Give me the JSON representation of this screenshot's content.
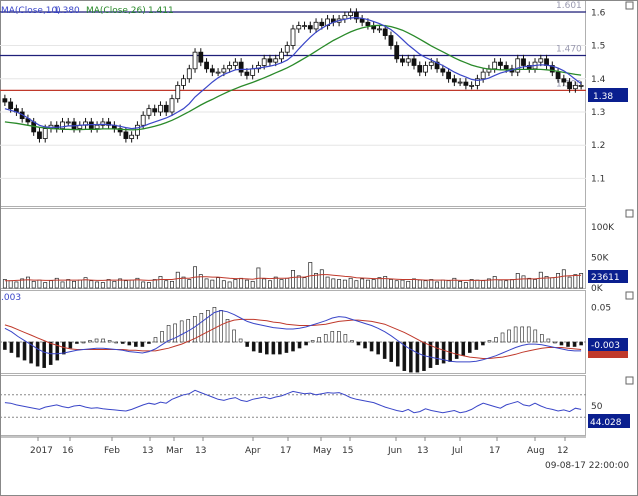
{
  "chart_data": [
    {
      "type": "line",
      "panel": "price",
      "description": "Daily candlestick price chart with moving averages and horizontal level lines",
      "legend": [
        {
          "name": "MA(Close,10)",
          "value_label": "1.380",
          "color": "#3a46c8"
        },
        {
          "name": "MA(Close,26)",
          "value_label": "1.411",
          "color": "#2a8a2a"
        }
      ],
      "y_ticks": [
        "1.6",
        "1.5",
        "1.4",
        "1.3",
        "1.2",
        "1.1"
      ],
      "ylim": [
        1.02,
        1.625
      ],
      "last_price_label": "1.38",
      "levels": [
        {
          "label": "1.601",
          "value": 1.601,
          "color": "#1f1f7a"
        },
        {
          "label": "1.470",
          "value": 1.47,
          "color": "#1f1f7a"
        },
        {
          "label": "1.300",
          "value": 1.365,
          "color": "#c0392b"
        }
      ],
      "close_series": [
        1.33,
        1.31,
        1.3,
        1.28,
        1.27,
        1.24,
        1.22,
        1.25,
        1.26,
        1.25,
        1.27,
        1.27,
        1.25,
        1.26,
        1.27,
        1.25,
        1.26,
        1.27,
        1.26,
        1.25,
        1.24,
        1.22,
        1.23,
        1.26,
        1.29,
        1.31,
        1.3,
        1.32,
        1.3,
        1.34,
        1.38,
        1.4,
        1.43,
        1.48,
        1.45,
        1.43,
        1.42,
        1.42,
        1.43,
        1.44,
        1.45,
        1.42,
        1.41,
        1.43,
        1.44,
        1.46,
        1.45,
        1.46,
        1.48,
        1.5,
        1.55,
        1.56,
        1.56,
        1.55,
        1.57,
        1.56,
        1.58,
        1.57,
        1.58,
        1.59,
        1.6,
        1.58,
        1.57,
        1.56,
        1.55,
        1.55,
        1.53,
        1.5,
        1.46,
        1.45,
        1.46,
        1.44,
        1.42,
        1.44,
        1.45,
        1.43,
        1.42,
        1.4,
        1.39,
        1.39,
        1.38,
        1.38,
        1.4,
        1.42,
        1.43,
        1.45,
        1.44,
        1.43,
        1.42,
        1.46,
        1.44,
        1.43,
        1.45,
        1.46,
        1.44,
        1.42,
        1.4,
        1.39,
        1.37,
        1.38,
        1.38
      ],
      "ma10": [
        1.31,
        1.305,
        1.3,
        1.292,
        1.282,
        1.27,
        1.26,
        1.255,
        1.254,
        1.254,
        1.255,
        1.258,
        1.258,
        1.26,
        1.261,
        1.262,
        1.262,
        1.263,
        1.262,
        1.26,
        1.257,
        1.253,
        1.25,
        1.252,
        1.257,
        1.264,
        1.27,
        1.276,
        1.282,
        1.29,
        1.3,
        1.31,
        1.325,
        1.345,
        1.36,
        1.375,
        1.39,
        1.403,
        1.413,
        1.42,
        1.427,
        1.428,
        1.428,
        1.43,
        1.432,
        1.435,
        1.438,
        1.442,
        1.448,
        1.456,
        1.47,
        1.49,
        1.508,
        1.525,
        1.54,
        1.552,
        1.562,
        1.57,
        1.575,
        1.579,
        1.583,
        1.584,
        1.582,
        1.578,
        1.572,
        1.566,
        1.558,
        1.548,
        1.534,
        1.518,
        1.502,
        1.488,
        1.474,
        1.464,
        1.456,
        1.448,
        1.44,
        1.43,
        1.42,
        1.412,
        1.405,
        1.398,
        1.395,
        1.397,
        1.402,
        1.41,
        1.417,
        1.422,
        1.426,
        1.432,
        1.436,
        1.438,
        1.44,
        1.442,
        1.441,
        1.438,
        1.432,
        1.424,
        1.412,
        1.398,
        1.385
      ],
      "ma26": [
        1.27,
        1.268,
        1.266,
        1.263,
        1.26,
        1.257,
        1.254,
        1.252,
        1.25,
        1.249,
        1.248,
        1.248,
        1.247,
        1.247,
        1.248,
        1.248,
        1.248,
        1.249,
        1.249,
        1.249,
        1.248,
        1.247,
        1.246,
        1.247,
        1.249,
        1.253,
        1.257,
        1.262,
        1.268,
        1.275,
        1.283,
        1.292,
        1.301,
        1.311,
        1.321,
        1.33,
        1.338,
        1.347,
        1.355,
        1.363,
        1.37,
        1.377,
        1.383,
        1.389,
        1.396,
        1.403,
        1.41,
        1.418,
        1.425,
        1.433,
        1.442,
        1.452,
        1.462,
        1.472,
        1.483,
        1.494,
        1.505,
        1.515,
        1.524,
        1.533,
        1.541,
        1.548,
        1.553,
        1.557,
        1.56,
        1.561,
        1.56,
        1.557,
        1.552,
        1.546,
        1.538,
        1.529,
        1.519,
        1.509,
        1.499,
        1.49,
        1.481,
        1.472,
        1.463,
        1.455,
        1.448,
        1.441,
        1.436,
        1.432,
        1.429,
        1.428,
        1.427,
        1.427,
        1.427,
        1.428,
        1.428,
        1.428,
        1.428,
        1.428,
        1.427,
        1.425,
        1.422,
        1.419,
        1.416,
        1.413,
        1.411
      ]
    },
    {
      "type": "bar",
      "panel": "volume",
      "y_ticks": [
        "100K",
        "50K",
        "0K"
      ],
      "ylim": [
        0,
        125
      ],
      "last_value_label": "23611",
      "values": [
        14,
        12,
        10,
        15,
        18,
        11,
        13,
        9,
        12,
        16,
        10,
        14,
        11,
        13,
        17,
        12,
        10,
        9,
        14,
        11,
        15,
        12,
        13,
        16,
        10,
        9,
        14,
        19,
        12,
        11,
        26,
        18,
        14,
        35,
        22,
        15,
        13,
        17,
        12,
        10,
        14,
        16,
        13,
        11,
        33,
        15,
        12,
        18,
        14,
        16,
        29,
        20,
        17,
        42,
        24,
        30,
        18,
        15,
        14,
        13,
        16,
        12,
        15,
        13,
        14,
        17,
        19,
        14,
        12,
        13,
        11,
        15,
        13,
        12,
        14,
        10,
        13,
        12,
        16,
        11,
        9,
        14,
        13,
        12,
        15,
        19,
        13,
        12,
        14,
        24,
        20,
        16,
        14,
        26,
        19,
        17,
        24,
        30,
        18,
        22,
        24
      ],
      "ma_line": [
        12,
        12,
        12.5,
        13,
        13.5,
        13,
        13,
        12.5,
        12.5,
        13,
        13,
        13,
        13,
        13,
        13.5,
        13,
        12.5,
        12.5,
        13,
        13,
        13,
        13,
        13,
        13.5,
        13,
        12.5,
        13,
        14,
        14,
        14,
        15.5,
        16,
        16,
        18,
        18.5,
        18.5,
        18,
        18,
        17,
        16,
        15.5,
        15.5,
        15,
        14.5,
        16,
        16,
        15.5,
        16,
        16,
        16,
        17.5,
        18,
        18,
        20,
        21,
        22,
        22,
        21,
        20,
        19,
        18.5,
        17,
        16.5,
        16,
        15.5,
        15.5,
        15.5,
        15,
        14.5,
        14,
        14,
        14,
        13.5,
        13,
        13,
        13,
        13,
        12.5,
        13,
        12.5,
        12.5,
        12.5,
        12.5,
        12.5,
        13,
        13.5,
        13.5,
        13.5,
        13.5,
        14.5,
        15,
        15,
        15,
        16,
        16.5,
        17,
        18,
        19.5,
        20,
        20.5,
        21
      ]
    },
    {
      "type": "line",
      "panel": "macd",
      "y_ticks": [
        "0.05"
      ],
      "last_value_label": "-0.003",
      "header_fragment": ".003",
      "ylim": [
        -0.04,
        0.07
      ],
      "macd": [
        0.02,
        0.015,
        0.008,
        0.002,
        -0.004,
        -0.01,
        -0.015,
        -0.017,
        -0.017,
        -0.016,
        -0.014,
        -0.012,
        -0.011,
        -0.01,
        -0.009,
        -0.009,
        -0.01,
        -0.011,
        -0.012,
        -0.014,
        -0.015,
        -0.016,
        -0.014,
        -0.01,
        -0.004,
        0.002,
        0.006,
        0.011,
        0.016,
        0.022,
        0.029,
        0.036,
        0.043,
        0.046,
        0.044,
        0.04,
        0.035,
        0.03,
        0.027,
        0.025,
        0.023,
        0.021,
        0.02,
        0.019,
        0.019,
        0.02,
        0.022,
        0.025,
        0.028,
        0.031,
        0.035,
        0.037,
        0.036,
        0.033,
        0.03,
        0.027,
        0.024,
        0.02,
        0.015,
        0.009,
        0.002,
        -0.005,
        -0.011,
        -0.016,
        -0.02,
        -0.022,
        -0.024,
        -0.026,
        -0.028,
        -0.029,
        -0.029,
        -0.029,
        -0.028,
        -0.026,
        -0.023,
        -0.02,
        -0.016,
        -0.012,
        -0.008,
        -0.005,
        -0.003,
        -0.003,
        -0.004,
        -0.006,
        -0.008,
        -0.01,
        -0.012,
        -0.013,
        -0.013
      ],
      "signal": [
        0.025,
        0.022,
        0.018,
        0.014,
        0.01,
        0.006,
        0.002,
        -0.002,
        -0.005,
        -0.008,
        -0.01,
        -0.011,
        -0.011,
        -0.011,
        -0.011,
        -0.011,
        -0.011,
        -0.011,
        -0.011,
        -0.012,
        -0.012,
        -0.013,
        -0.013,
        -0.013,
        -0.011,
        -0.009,
        -0.006,
        -0.003,
        0.001,
        0.005,
        0.01,
        0.015,
        0.02,
        0.025,
        0.029,
        0.032,
        0.033,
        0.033,
        0.033,
        0.032,
        0.031,
        0.029,
        0.028,
        0.026,
        0.025,
        0.024,
        0.024,
        0.024,
        0.025,
        0.026,
        0.028,
        0.03,
        0.031,
        0.032,
        0.032,
        0.031,
        0.03,
        0.028,
        0.026,
        0.022,
        0.018,
        0.014,
        0.009,
        0.004,
        -0.001,
        -0.005,
        -0.009,
        -0.012,
        -0.015,
        -0.018,
        -0.02,
        -0.022,
        -0.023,
        -0.024,
        -0.024,
        -0.023,
        -0.022,
        -0.02,
        -0.018,
        -0.015,
        -0.013,
        -0.011,
        -0.009,
        -0.008,
        -0.008,
        -0.008,
        -0.009,
        -0.01,
        -0.011
      ]
    },
    {
      "type": "line",
      "panel": "rsi",
      "y_ticks": [
        "50"
      ],
      "ylim": [
        0,
        100
      ],
      "last_value_label": "44.028",
      "values": [
        56,
        55,
        52,
        50,
        48,
        46,
        44,
        48,
        50,
        52,
        49,
        47,
        50,
        51,
        48,
        46,
        47,
        45,
        44,
        43,
        42,
        41,
        44,
        48,
        52,
        55,
        53,
        57,
        55,
        62,
        66,
        70,
        72,
        78,
        74,
        70,
        66,
        62,
        60,
        63,
        65,
        60,
        58,
        62,
        64,
        66,
        63,
        66,
        68,
        72,
        76,
        74,
        72,
        73,
        70,
        72,
        74,
        73,
        74,
        70,
        65,
        62,
        60,
        58,
        56,
        52,
        48,
        45,
        42,
        40,
        44,
        38,
        40,
        45,
        42,
        40,
        38,
        40,
        42,
        38,
        40,
        44,
        50,
        55,
        52,
        49,
        46,
        52,
        55,
        58,
        52,
        50,
        55,
        50,
        46,
        44,
        41,
        43,
        40,
        46,
        44
      ],
      "ref_lines": [
        70,
        30
      ]
    }
  ],
  "x_axis": {
    "labels": [
      "2017",
      "16",
      "Feb",
      "13",
      "Mar",
      "13",
      "Apr",
      "17",
      "May",
      "15",
      "Jun",
      "13",
      "Jul",
      "17",
      "Aug",
      "12"
    ],
    "timestamp": "09-08-17 22:00:00"
  },
  "colors": {
    "ma10": "#3a46c8",
    "ma26": "#2a8a2a",
    "level_blue": "#1f1f7a",
    "level_red": "#c0392b",
    "price_badge": "#0a1f8f",
    "macd_badge": "#0a1f8f",
    "rsi_badge": "#0a1f8f",
    "signal_badge": "#c0392b",
    "volume_ma": "#c0392b"
  }
}
